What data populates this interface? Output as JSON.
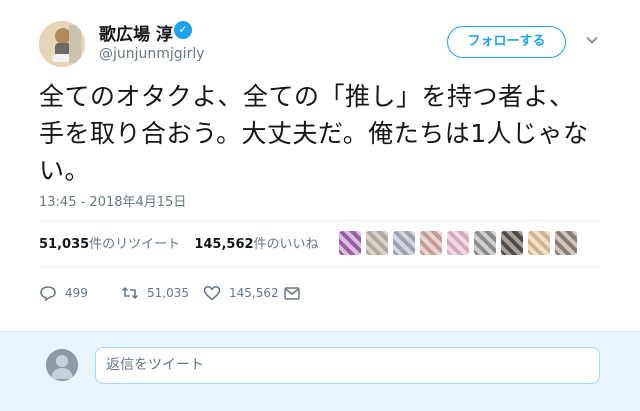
{
  "user": {
    "display_name": "歌広場 淳",
    "handle": "@junjunmjgirly",
    "verified_icon": "verified-badge-icon",
    "follow_label": "フォローする"
  },
  "tweet": {
    "text": "全てのオタクよ、全ての「推し」を持つ者よ、手を取り合おう。大丈夫だ。俺たちは1人じゃない。",
    "timestamp": "13:45 - 2018年4月15日"
  },
  "stats": {
    "retweets_count": "51,035",
    "retweets_label": "件のリツイート",
    "likes_count": "145,562",
    "likes_label": "件のいいね"
  },
  "actions": {
    "reply_count": "499",
    "retweet_count": "51,035",
    "like_count": "145,562"
  },
  "reply": {
    "placeholder": "返信をツイート"
  },
  "colors": {
    "accent": "#1da1f2",
    "secondary_text": "#657786",
    "reply_bar_bg": "#e8f5fd"
  }
}
